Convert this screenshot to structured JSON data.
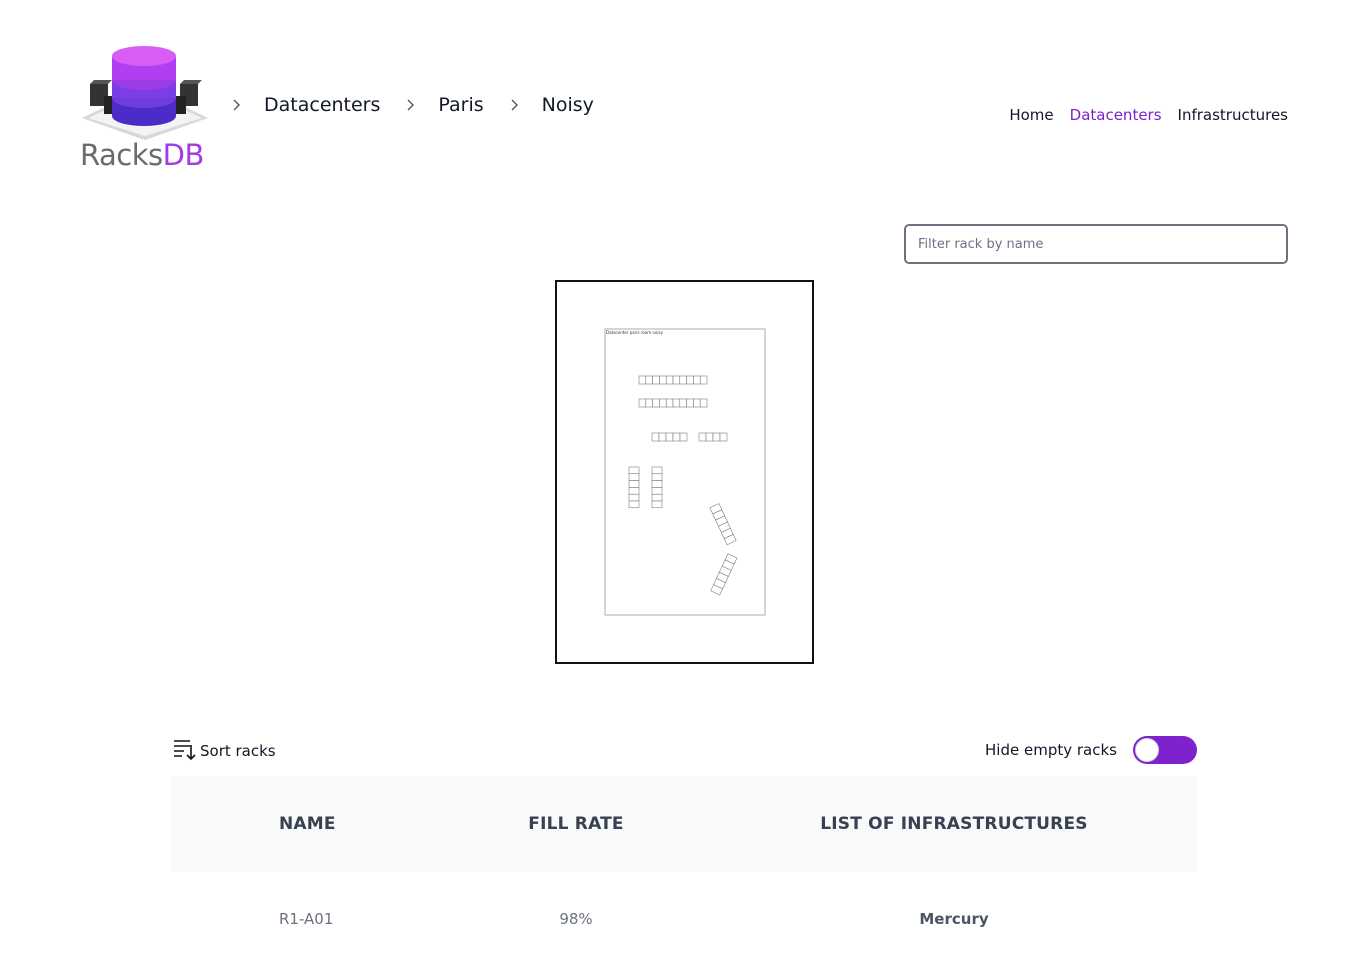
{
  "app": {
    "logo_text_1": "Racks",
    "logo_text_2": "DB",
    "brand_color": "#a23be6",
    "accent_color": "#7e22ce"
  },
  "breadcrumb": {
    "items": [
      "Datacenters",
      "Paris",
      "Noisy"
    ]
  },
  "nav": {
    "home": "Home",
    "datacenters": "Datacenters",
    "infrastructures": "Infrastructures",
    "active": "Datacenters"
  },
  "filter": {
    "placeholder": "Filter rack by name",
    "value": ""
  },
  "map": {
    "caption": "Datacenter paris room noisy"
  },
  "controls": {
    "sort_label": "Sort racks",
    "hide_empty_label": "Hide empty racks",
    "hide_empty_enabled": true
  },
  "table": {
    "headers": [
      "Name",
      "Fill rate",
      "List of infrastructures"
    ],
    "rows": [
      {
        "name": "R1-A01",
        "fill_rate": "98%",
        "infrastructures": "Mercury"
      }
    ]
  }
}
